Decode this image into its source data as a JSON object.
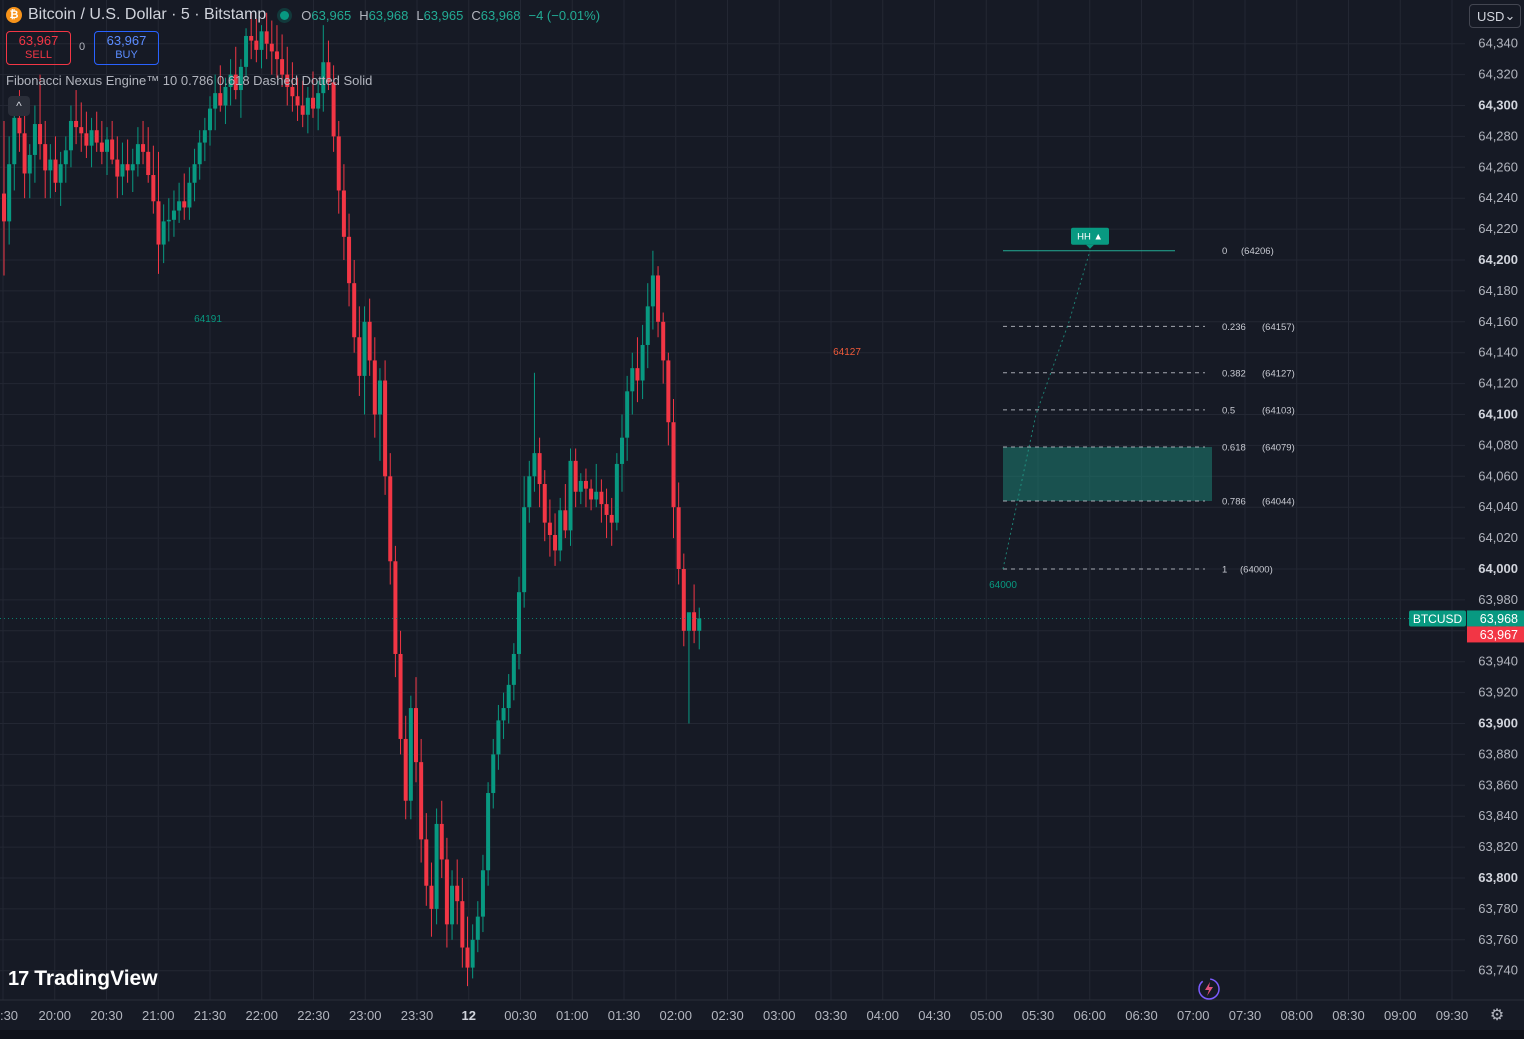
{
  "header": {
    "symbol_title": "Bitcoin / U.S. Dollar · 5 · Bitstamp",
    "coin_glyph": "₿",
    "ohlc": {
      "o_label": "O",
      "o": "63,965",
      "h_label": "H",
      "h": "63,968",
      "l_label": "L",
      "l": "63,965",
      "c_label": "C",
      "c": "63,968",
      "change": "−4 (−0.01%)"
    }
  },
  "trade": {
    "sell_price": "63,967",
    "sell_label": "SELL",
    "spread": "0",
    "buy_price": "63,967",
    "buy_label": "BUY"
  },
  "indicator": {
    "legend": "Fibonacci Nexus Engine™ 10 0.786 0.618 Dashed Dotted Solid",
    "collapse_glyph": "^"
  },
  "currency": {
    "value": "USD",
    "chevron": "⌄"
  },
  "branding": {
    "logo_text": "TradingView",
    "mark": "17"
  },
  "colors": {
    "background": "#161a25",
    "up": "#089981",
    "down": "#f23645",
    "grid": "#232733",
    "text": "#b2b5be",
    "fib_zone": "#1e7f73"
  },
  "icons": {
    "settings": "gear-icon",
    "magic": "magic-wand-icon"
  },
  "chart_data": {
    "type": "candlestick",
    "symbol": "BTCUSD",
    "interval": "5",
    "exchange": "Bitstamp",
    "ylim": [
      63727,
      64355
    ],
    "y_ticks": [
      64340,
      64320,
      64300,
      64280,
      64260,
      64240,
      64220,
      64200,
      64180,
      64160,
      64140,
      64120,
      64100,
      64080,
      64060,
      64040,
      64020,
      64000,
      63980,
      63960,
      63940,
      63920,
      63900,
      63880,
      63860,
      63840,
      63820,
      63800,
      63780,
      63760,
      63740
    ],
    "y_tick_labels": [
      "64,340",
      "64,320",
      "64,300",
      "64,280",
      "64,260",
      "64,240",
      "64,220",
      "64,200",
      "64,180",
      "64,160",
      "64,140",
      "64,120",
      "64,100",
      "64,080",
      "64,060",
      "64,040",
      "64,020",
      "64,000",
      "63,980",
      "63,960",
      "63,940",
      "63,920",
      "63,900",
      "63,880",
      "63,860",
      "63,840",
      "63,820",
      "63,800",
      "63,780",
      "63,760",
      "63,740"
    ],
    "x_ticks": [
      ":30",
      "20:00",
      "20:30",
      "21:00",
      "21:30",
      "22:00",
      "22:30",
      "23:00",
      "23:30",
      "12",
      "00:30",
      "01:00",
      "01:30",
      "02:00",
      "02:30",
      "03:00",
      "03:30",
      "04:00",
      "04:30",
      "05:00",
      "05:30",
      "06:00",
      "06:30",
      "07:00",
      "07:30",
      "08:00",
      "08:30",
      "09:00",
      "09:30"
    ],
    "last_price": {
      "symbol_tag": "BTCUSD",
      "value": 63968,
      "label": "63,968",
      "bid_label": "63,967",
      "bid": 63967
    },
    "candles": [
      [
        64243,
        64290,
        64190,
        64225
      ],
      [
        64225,
        64280,
        64210,
        64262
      ],
      [
        64262,
        64300,
        64245,
        64292
      ],
      [
        64292,
        64310,
        64270,
        64282
      ],
      [
        64282,
        64300,
        64240,
        64256
      ],
      [
        64256,
        64275,
        64240,
        64268
      ],
      [
        64268,
        64300,
        64250,
        64288
      ],
      [
        64288,
        64320,
        64265,
        64275
      ],
      [
        64275,
        64290,
        64240,
        64258
      ],
      [
        64258,
        64275,
        64240,
        64265
      ],
      [
        64265,
        64280,
        64244,
        64250
      ],
      [
        64250,
        64270,
        64235,
        64262
      ],
      [
        64262,
        64280,
        64250,
        64271
      ],
      [
        64271,
        64300,
        64260,
        64290
      ],
      [
        64290,
        64310,
        64275,
        64286
      ],
      [
        64286,
        64302,
        64270,
        64282
      ],
      [
        64282,
        64296,
        64266,
        64274
      ],
      [
        64274,
        64292,
        64260,
        64284
      ],
      [
        64284,
        64296,
        64270,
        64276
      ],
      [
        64276,
        64290,
        64262,
        64270
      ],
      [
        64270,
        64286,
        64255,
        64278
      ],
      [
        64278,
        64290,
        64262,
        64265
      ],
      [
        64265,
        64280,
        64240,
        64254
      ],
      [
        64254,
        64276,
        64242,
        64262
      ],
      [
        64262,
        64278,
        64250,
        64258
      ],
      [
        64258,
        64272,
        64244,
        64262
      ],
      [
        64262,
        64286,
        64254,
        64275
      ],
      [
        64275,
        64290,
        64262,
        64270
      ],
      [
        64270,
        64286,
        64250,
        64255
      ],
      [
        64255,
        64274,
        64230,
        64238
      ],
      [
        64238,
        64270,
        64191,
        64210
      ],
      [
        64210,
        64236,
        64198,
        64225
      ],
      [
        64225,
        64240,
        64212,
        64226
      ],
      [
        64226,
        64245,
        64215,
        64232
      ],
      [
        64232,
        64250,
        64224,
        64238
      ],
      [
        64238,
        64256,
        64226,
        64234
      ],
      [
        64234,
        64260,
        64226,
        64250
      ],
      [
        64250,
        64272,
        64238,
        64262
      ],
      [
        64262,
        64284,
        64252,
        64276
      ],
      [
        64276,
        64292,
        64264,
        64284
      ],
      [
        64284,
        64306,
        64274,
        64298
      ],
      [
        64298,
        64320,
        64284,
        64308
      ],
      [
        64308,
        64326,
        64296,
        64300
      ],
      [
        64300,
        64318,
        64288,
        64312
      ],
      [
        64312,
        64330,
        64300,
        64320
      ],
      [
        64320,
        64338,
        64304,
        64310
      ],
      [
        64310,
        64330,
        64292,
        64325
      ],
      [
        64325,
        64350,
        64318,
        64345
      ],
      [
        64345,
        64360,
        64330,
        64342
      ],
      [
        64342,
        64356,
        64328,
        64336
      ],
      [
        64336,
        64352,
        64324,
        64348
      ],
      [
        64348,
        64360,
        64330,
        64340
      ],
      [
        64340,
        64355,
        64320,
        64335
      ],
      [
        64335,
        64352,
        64318,
        64330
      ],
      [
        64330,
        64346,
        64312,
        64320
      ],
      [
        64320,
        64338,
        64300,
        64312
      ],
      [
        64312,
        64328,
        64296,
        64306
      ],
      [
        64306,
        64318,
        64290,
        64300
      ],
      [
        64300,
        64316,
        64286,
        64294
      ],
      [
        64294,
        64312,
        64282,
        64305
      ],
      [
        64305,
        64322,
        64292,
        64298
      ],
      [
        64298,
        64316,
        64284,
        64308
      ],
      [
        64308,
        64352,
        64296,
        64328
      ],
      [
        64328,
        64342,
        64310,
        64315
      ],
      [
        64315,
        64326,
        64270,
        64280
      ],
      [
        64280,
        64290,
        64230,
        64245
      ],
      [
        64245,
        64262,
        64200,
        64215
      ],
      [
        64215,
        64230,
        64170,
        64185
      ],
      [
        64185,
        64200,
        64140,
        64150
      ],
      [
        64150,
        64170,
        64112,
        64125
      ],
      [
        64125,
        64170,
        64100,
        64160
      ],
      [
        64160,
        64175,
        64125,
        64135
      ],
      [
        64135,
        64150,
        64085,
        64100
      ],
      [
        64100,
        64130,
        64070,
        64122
      ],
      [
        64122,
        64135,
        64048,
        64060
      ],
      [
        64060,
        64075,
        63990,
        64005
      ],
      [
        64005,
        64015,
        63930,
        63945
      ],
      [
        63945,
        63960,
        63880,
        63890
      ],
      [
        63890,
        63905,
        63838,
        63850
      ],
      [
        63850,
        63918,
        63838,
        63910
      ],
      [
        63910,
        63930,
        63862,
        63875
      ],
      [
        63875,
        63890,
        63810,
        63825
      ],
      [
        63825,
        63842,
        63782,
        63795
      ],
      [
        63795,
        63810,
        63762,
        63780
      ],
      [
        63780,
        63845,
        63770,
        63835
      ],
      [
        63835,
        63850,
        63800,
        63812
      ],
      [
        63812,
        63826,
        63755,
        63770
      ],
      [
        63770,
        63805,
        63760,
        63795
      ],
      [
        63795,
        63812,
        63770,
        63785
      ],
      [
        63785,
        63800,
        63742,
        63755
      ],
      [
        63755,
        63775,
        63730,
        63742
      ],
      [
        63742,
        63770,
        63735,
        63760
      ],
      [
        63760,
        63785,
        63752,
        63775
      ],
      [
        63775,
        63815,
        63765,
        63805
      ],
      [
        63805,
        63862,
        63795,
        63855
      ],
      [
        63855,
        63890,
        63845,
        63880
      ],
      [
        63880,
        63912,
        63870,
        63902
      ],
      [
        63902,
        63920,
        63890,
        63910
      ],
      [
        63910,
        63932,
        63900,
        63925
      ],
      [
        63925,
        63952,
        63915,
        63945
      ],
      [
        63945,
        63995,
        63935,
        63985
      ],
      [
        63985,
        64060,
        63975,
        64040
      ],
      [
        64040,
        64070,
        64030,
        64060
      ],
      [
        64060,
        64127,
        64050,
        64075
      ],
      [
        64075,
        64085,
        64040,
        64055
      ],
      [
        64055,
        64064,
        64018,
        64030
      ],
      [
        64030,
        64045,
        64008,
        64022
      ],
      [
        64022,
        64036,
        64002,
        64012
      ],
      [
        64012,
        64046,
        64005,
        64038
      ],
      [
        64038,
        64055,
        64020,
        64025
      ],
      [
        64025,
        64078,
        64015,
        64070
      ],
      [
        64070,
        64078,
        64040,
        64050
      ],
      [
        64050,
        64062,
        64042,
        64057
      ],
      [
        64057,
        64065,
        64040,
        64052
      ],
      [
        64052,
        64058,
        64038,
        64045
      ],
      [
        64045,
        64068,
        64040,
        64050
      ],
      [
        64050,
        64058,
        64030,
        64042
      ],
      [
        64042,
        64052,
        64020,
        64035
      ],
      [
        64035,
        64046,
        64015,
        64030
      ],
      [
        64030,
        64075,
        64025,
        64068
      ],
      [
        64068,
        64100,
        64050,
        64085
      ],
      [
        64085,
        64125,
        64070,
        64115
      ],
      [
        64115,
        64140,
        64100,
        64130
      ],
      [
        64130,
        64150,
        64108,
        64122
      ],
      [
        64122,
        64158,
        64110,
        64145
      ],
      [
        64145,
        64185,
        64130,
        64170
      ],
      [
        64170,
        64206,
        64155,
        64190
      ],
      [
        64190,
        64196,
        64150,
        64160
      ],
      [
        64160,
        64166,
        64120,
        64135
      ],
      [
        64135,
        64140,
        64080,
        64095
      ],
      [
        64095,
        64110,
        64020,
        64040
      ],
      [
        64040,
        64056,
        63990,
        64000
      ],
      [
        64000,
        64010,
        63950,
        63960
      ],
      [
        63960,
        63970,
        63900,
        63972
      ],
      [
        63972,
        63990,
        63952,
        63960
      ],
      [
        63960,
        63975,
        63948,
        63968
      ]
    ],
    "annotations": [
      {
        "label": "64191",
        "price": 64191,
        "kind": "swing-low"
      },
      {
        "label": "64127",
        "price": 64127,
        "kind": "swing-high"
      },
      {
        "label": "64000",
        "price": 64000,
        "kind": "swing-low"
      },
      {
        "label": "HH ▲",
        "price": 64206,
        "kind": "higher-high"
      }
    ],
    "fib_levels": [
      {
        "ratio": "0",
        "price": 64206,
        "label": "(64206)",
        "style": "solid"
      },
      {
        "ratio": "0.236",
        "price": 64157,
        "label": "(64157)",
        "style": "dashed"
      },
      {
        "ratio": "0.382",
        "price": 64127,
        "label": "(64127)",
        "style": "dashed"
      },
      {
        "ratio": "0.5",
        "price": 64103,
        "label": "(64103)",
        "style": "dashed"
      },
      {
        "ratio": "0.618",
        "price": 64079,
        "label": "(64079)",
        "style": "dashed"
      },
      {
        "ratio": "0.786",
        "price": 64044,
        "label": "(64044)",
        "style": "dashed"
      },
      {
        "ratio": "1",
        "price": 64000,
        "label": "(64000)",
        "style": "dashed"
      }
    ],
    "golden_zone": {
      "top": 64079,
      "bottom": 64044
    }
  }
}
